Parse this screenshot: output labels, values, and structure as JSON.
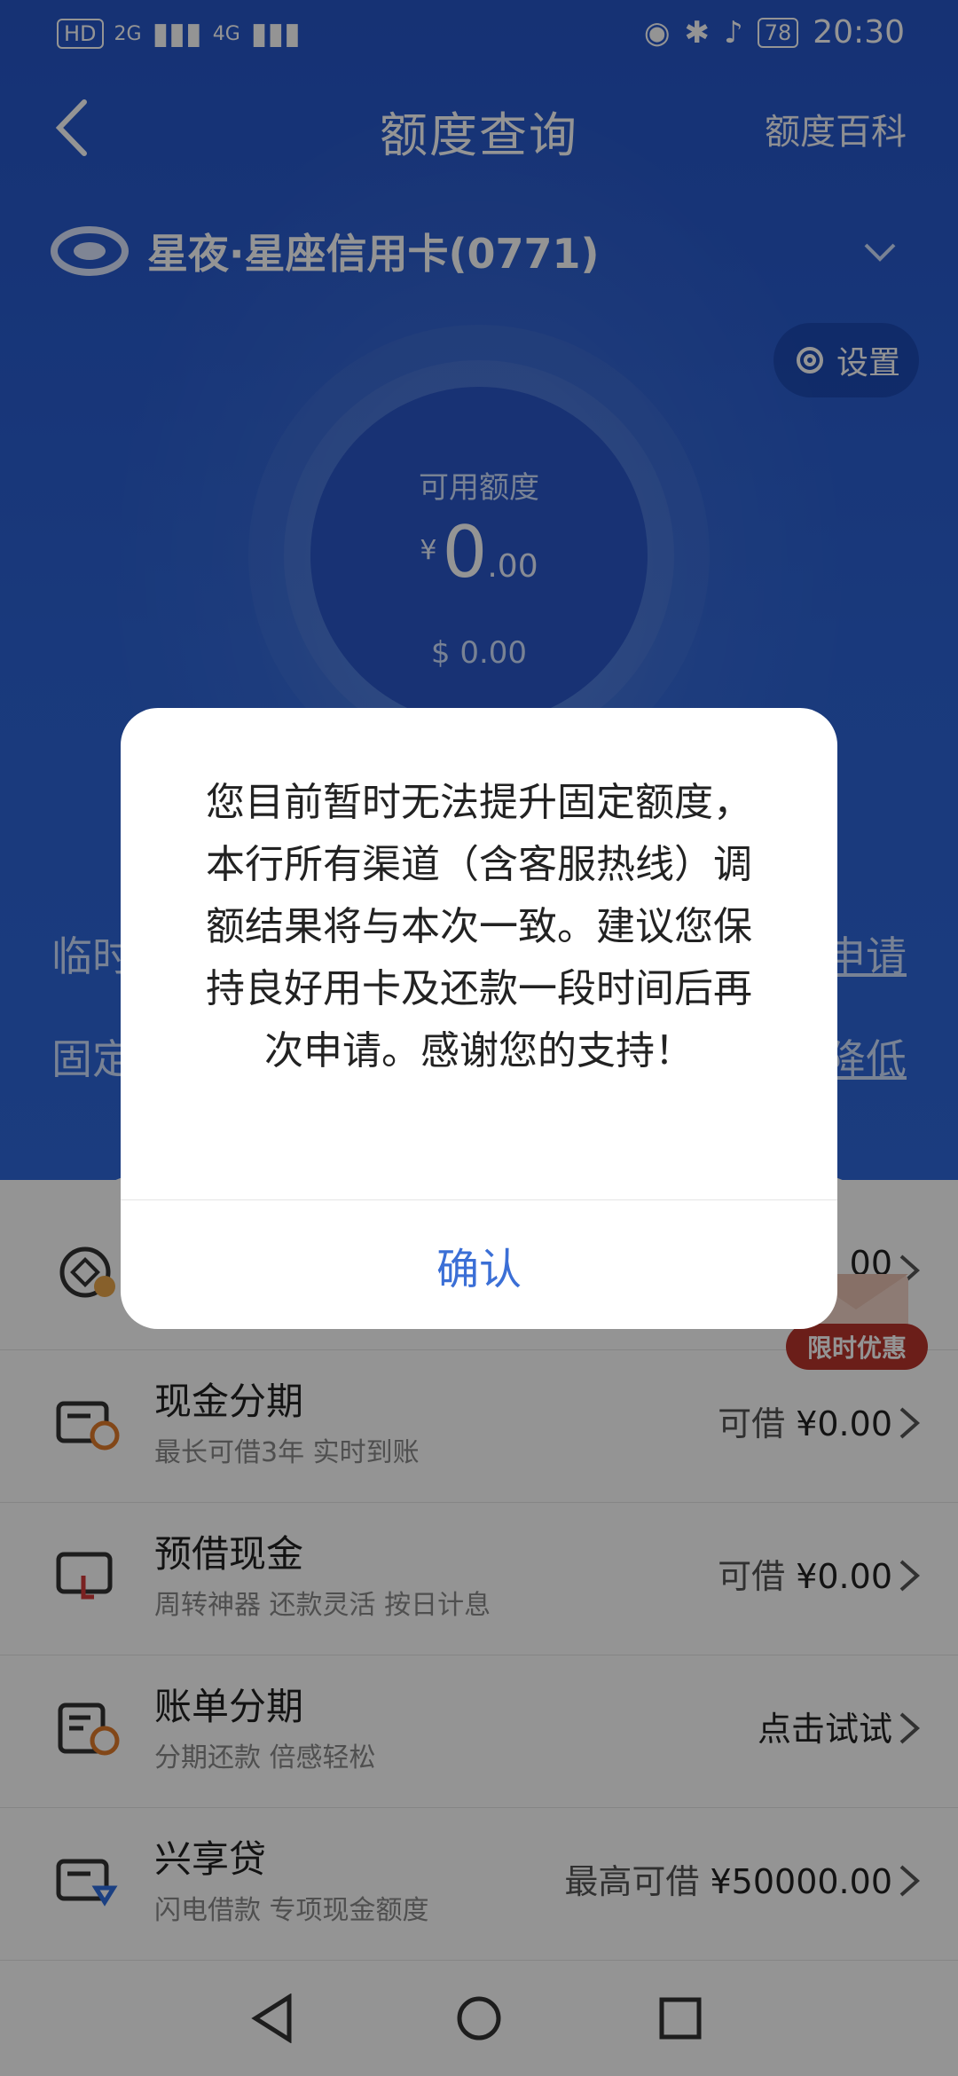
{
  "status_bar": {
    "left_labels": [
      "HD",
      "2G",
      "4G"
    ],
    "battery": "78",
    "time": "20:30"
  },
  "nav": {
    "title": "额度查询",
    "right_link": "额度百科"
  },
  "card": {
    "name": "星夜·星座信用卡(0771)"
  },
  "settings": {
    "label": "设置"
  },
  "available": {
    "label": "可用额度",
    "currency": "¥",
    "int": "0",
    "dec": ".00",
    "usd": "$ 0.00"
  },
  "hidden_rows": {
    "temp_prefix": "临时",
    "temp_link": "申请",
    "fixed_prefix": "固定",
    "fixed_link": "降低"
  },
  "list": [
    {
      "title": "",
      "sub": "",
      "right_prefix": "",
      "right_value": "00",
      "icon": "coin-icon"
    },
    {
      "title": "现金分期",
      "sub": "最长可借3年 实时到账",
      "right_prefix": "可借 ",
      "right_value": "¥0.00",
      "icon": "card-clock-icon"
    },
    {
      "title": "预借现金",
      "sub": "周转神器 还款灵活 按日计息",
      "right_prefix": "可借 ",
      "right_value": "¥0.00",
      "icon": "card-swap-icon"
    },
    {
      "title": "账单分期",
      "sub": "分期还款 倍感轻松",
      "right_prefix": "",
      "right_value": "点击试试",
      "icon": "bill-clock-icon"
    },
    {
      "title": "兴享贷",
      "sub": "闪电借款 专项现金额度",
      "right_prefix": "最高可借 ",
      "right_value": "¥50000.00",
      "icon": "card-diamond-icon"
    }
  ],
  "promo": {
    "label": "限时优惠"
  },
  "dialog": {
    "message": "您目前暂时无法提升固定额度，本行所有渠道（含客服热线）调额结果将与本次一致。建议您保持良好用卡及还款一段时间后再次申请。感谢您的支持！",
    "confirm": "确认"
  },
  "colors": {
    "primary_blue": "#2a5fd0",
    "dialog_button": "#3b6fd6",
    "promo_red": "#b8342c"
  }
}
